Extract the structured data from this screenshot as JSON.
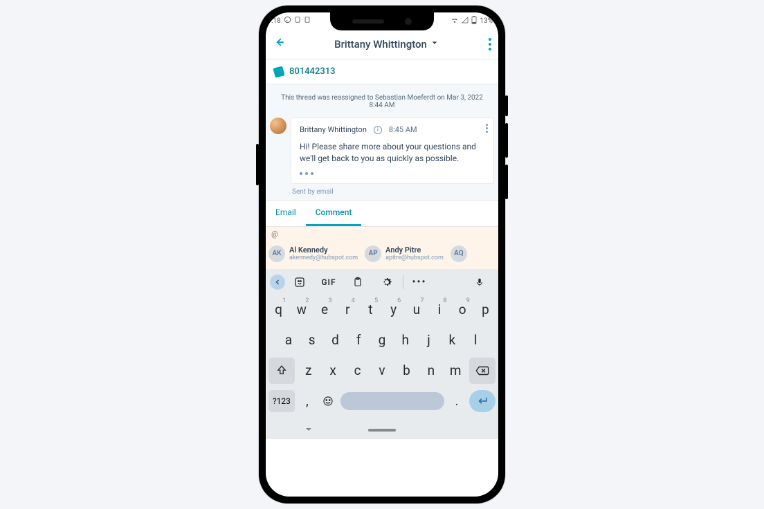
{
  "status": {
    "time": ":18",
    "battery": "13%"
  },
  "header": {
    "contact_name": "Brittany Whittington"
  },
  "ticket": {
    "number": "801442313"
  },
  "thread": {
    "reassign_note": "This thread was reassigned to Sebastian Moeferdt on Mar 3, 2022 8:44 AM",
    "message": {
      "sender": "Brittany Whittington",
      "time": "8:45 AM",
      "body": "Hi! Please share more about your questions and we'll get back to you as quickly as possible.",
      "sent_by": "Sent by email"
    }
  },
  "compose": {
    "tab_email": "Email",
    "tab_comment": "Comment",
    "mention_symbol": "@",
    "contacts": [
      {
        "initials": "AK",
        "name": "Al Kennedy",
        "email": "akennedy@hubspot.com"
      },
      {
        "initials": "AP",
        "name": "Andy Pitre",
        "email": "apitre@hubspot.com"
      },
      {
        "initials": "AQ",
        "name": "",
        "email": ""
      }
    ]
  },
  "keyboard": {
    "toolbar": {
      "gif": "GIF"
    },
    "row1": [
      {
        "k": "q",
        "n": "1"
      },
      {
        "k": "w",
        "n": "2"
      },
      {
        "k": "e",
        "n": "3"
      },
      {
        "k": "r",
        "n": "4"
      },
      {
        "k": "t",
        "n": "5"
      },
      {
        "k": "y",
        "n": "6"
      },
      {
        "k": "u",
        "n": "7"
      },
      {
        "k": "i",
        "n": "8"
      },
      {
        "k": "o",
        "n": "9"
      },
      {
        "k": "p",
        "n": ""
      }
    ],
    "row2": [
      "a",
      "s",
      "d",
      "f",
      "g",
      "h",
      "j",
      "k",
      "l"
    ],
    "row3": [
      "z",
      "x",
      "c",
      "v",
      "b",
      "n",
      "m"
    ],
    "numtoggle": "?123",
    "comma": ",",
    "period": "."
  }
}
